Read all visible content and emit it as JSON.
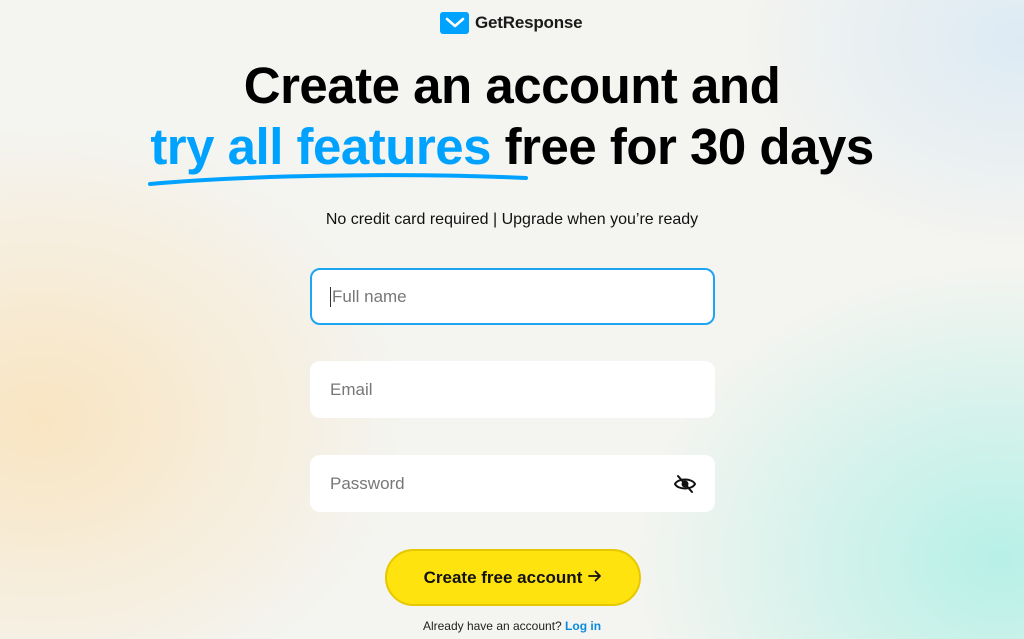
{
  "brand": {
    "name": "GetResponse",
    "accent": "#00a2ff"
  },
  "headline": {
    "line1": "Create an account and",
    "highlight": "try all features",
    "line2_rest": "free for 30 days"
  },
  "subtitle": "No credit card required | Upgrade when you’re ready",
  "form": {
    "full_name": {
      "placeholder": "Full name",
      "value": ""
    },
    "email": {
      "placeholder": "Email",
      "value": ""
    },
    "password": {
      "placeholder": "Password",
      "value": "",
      "toggle_icon": "eye-slash-icon"
    }
  },
  "cta": {
    "label": "Create free account",
    "icon": "arrow-right-icon",
    "color": "#ffe30e"
  },
  "footer": {
    "prompt": "Already have an account?",
    "link": "Log in"
  }
}
